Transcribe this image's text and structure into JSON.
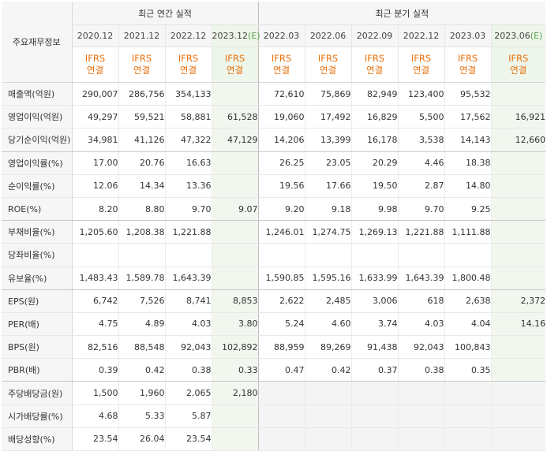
{
  "corner_label": "주요재무정보",
  "group_annual": "최근 연간 실적",
  "group_quarter": "최근 분기 실적",
  "estimate_mark": "(E)",
  "ifrs_top": "IFRS",
  "ifrs_bottom": "연결",
  "periods": [
    {
      "label": "2020.12",
      "est": false
    },
    {
      "label": "2021.12",
      "est": false
    },
    {
      "label": "2022.12",
      "est": false
    },
    {
      "label": "2023.12",
      "est": true
    },
    {
      "label": "2022.03",
      "est": false
    },
    {
      "label": "2022.06",
      "est": false
    },
    {
      "label": "2022.09",
      "est": false
    },
    {
      "label": "2022.12",
      "est": false
    },
    {
      "label": "2023.03",
      "est": false
    },
    {
      "label": "2023.06",
      "est": true
    }
  ],
  "rows": [
    {
      "label": "매출액(억원)",
      "values": [
        "290,007",
        "286,756",
        "354,133",
        "",
        "72,610",
        "75,869",
        "82,949",
        "123,400",
        "95,532",
        ""
      ]
    },
    {
      "label": "영업이익(억원)",
      "values": [
        "49,297",
        "59,521",
        "58,881",
        "61,528",
        "19,060",
        "17,492",
        "16,829",
        "5,500",
        "17,562",
        "16,921"
      ]
    },
    {
      "label": "당기순이익(억원)",
      "values": [
        "34,981",
        "41,126",
        "47,322",
        "47,129",
        "14,206",
        "13,399",
        "16,178",
        "3,538",
        "14,143",
        "12,660"
      ],
      "groupEnd": true
    },
    {
      "label": "영업이익률(%)",
      "values": [
        "17.00",
        "20.76",
        "16.63",
        "",
        "26.25",
        "23.05",
        "20.29",
        "4.46",
        "18.38",
        ""
      ]
    },
    {
      "label": "순이익률(%)",
      "values": [
        "12.06",
        "14.34",
        "13.36",
        "",
        "19.56",
        "17.66",
        "19.50",
        "2.87",
        "14.80",
        ""
      ]
    },
    {
      "label": "ROE(%)",
      "values": [
        "8.20",
        "8.80",
        "9.70",
        "9.07",
        "9.20",
        "9.18",
        "9.98",
        "9.70",
        "9.25",
        ""
      ],
      "groupEnd": true
    },
    {
      "label": "부채비율(%)",
      "values": [
        "1,205.60",
        "1,208.38",
        "1,221.88",
        "",
        "1,246.01",
        "1,274.75",
        "1,269.13",
        "1,221.88",
        "1,111.88",
        ""
      ]
    },
    {
      "label": "당좌비율(%)",
      "values": [
        "",
        "",
        "",
        "",
        "",
        "",
        "",
        "",
        "",
        ""
      ]
    },
    {
      "label": "유보율(%)",
      "values": [
        "1,483.43",
        "1,589.78",
        "1,643.39",
        "",
        "1,590.85",
        "1,595.16",
        "1,633.99",
        "1,643.39",
        "1,800.48",
        ""
      ],
      "groupEnd": true
    },
    {
      "label": "EPS(원)",
      "values": [
        "6,742",
        "7,526",
        "8,741",
        "8,853",
        "2,622",
        "2,485",
        "3,006",
        "618",
        "2,638",
        "2,372"
      ]
    },
    {
      "label": "PER(배)",
      "values": [
        "4.75",
        "4.89",
        "4.03",
        "3.80",
        "5.24",
        "4.60",
        "3.74",
        "4.03",
        "4.04",
        "14.16"
      ]
    },
    {
      "label": "BPS(원)",
      "values": [
        "82,516",
        "88,548",
        "92,043",
        "102,892",
        "88,959",
        "89,269",
        "91,438",
        "92,043",
        "100,843",
        ""
      ]
    },
    {
      "label": "PBR(배)",
      "values": [
        "0.39",
        "0.42",
        "0.38",
        "0.33",
        "0.47",
        "0.42",
        "0.37",
        "0.38",
        "0.35",
        ""
      ],
      "groupEnd": true
    },
    {
      "label": "주당배당금(원)",
      "values": [
        "1,500",
        "1,960",
        "2,065",
        "2,180",
        "",
        "",
        "",
        "",
        "",
        ""
      ],
      "quarterBlank": true
    },
    {
      "label": "시가배당률(%)",
      "values": [
        "4.68",
        "5.33",
        "5.87",
        "",
        "",
        "",
        "",
        "",
        "",
        ""
      ],
      "quarterBlank": true
    },
    {
      "label": "배당성향(%)",
      "values": [
        "23.54",
        "26.04",
        "23.54",
        "",
        "",
        "",
        "",
        "",
        "",
        ""
      ],
      "quarterBlank": true
    }
  ]
}
